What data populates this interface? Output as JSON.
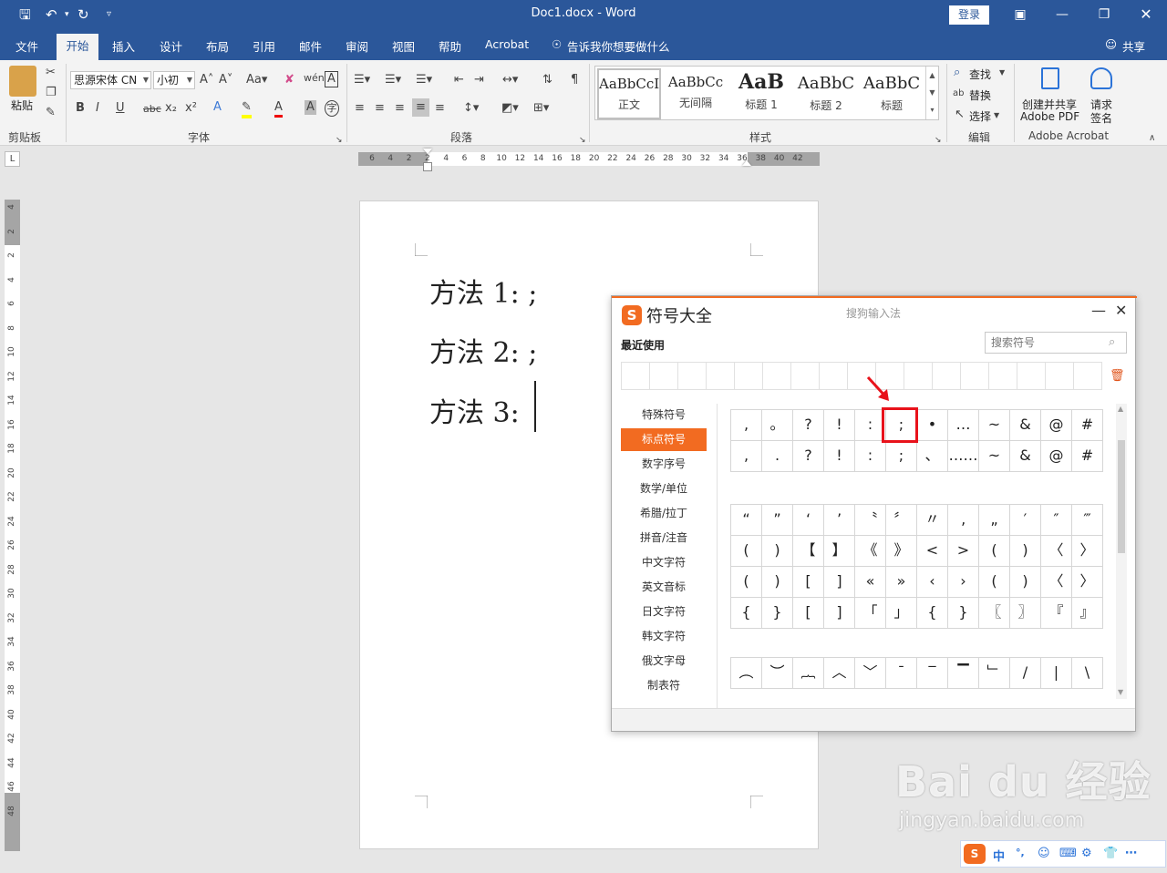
{
  "window": {
    "doc_title": "Doc1.docx  -  Word",
    "login": "登录",
    "restore_icon": "restore-window",
    "minimize_icon": "minimize",
    "maximize_icon": "maximize",
    "close_icon": "close"
  },
  "tabs": [
    "文件",
    "开始",
    "插入",
    "设计",
    "布局",
    "引用",
    "邮件",
    "审阅",
    "视图",
    "帮助",
    "Acrobat"
  ],
  "tell_me": "告诉我你想要做什么",
  "share": "共享",
  "ribbon": {
    "paste": "粘贴",
    "clipboard": "剪贴板",
    "font_name": "思源宋体 CN",
    "font_size": "小初",
    "font_group": "字体",
    "para_group": "段落",
    "styles_group": "样式",
    "edit_group": "编辑",
    "acrobat_group": "Adobe Acrobat",
    "find": "查找",
    "replace": "替换",
    "select": "选择",
    "create_pdf_1": "创建并共享",
    "create_pdf_2": "Adobe PDF",
    "request_sign_1": "请求",
    "request_sign_2": "签名",
    "styles": [
      {
        "preview": "AaBbCcI",
        "name": "正文"
      },
      {
        "preview": "AaBbCc",
        "name": "无间隔"
      },
      {
        "preview": "AaB",
        "name": "标题 1"
      },
      {
        "preview": "AaBbC",
        "name": "标题 2"
      },
      {
        "preview": "AaBbC",
        "name": "标题"
      }
    ]
  },
  "ruler_h": [
    "6",
    "4",
    "2",
    "2",
    "4",
    "6",
    "8",
    "10",
    "12",
    "14",
    "16",
    "18",
    "20",
    "22",
    "24",
    "26",
    "28",
    "30",
    "32",
    "34",
    "36",
    "38",
    "40",
    "42"
  ],
  "ruler_v": [
    "4",
    "2",
    "2",
    "4",
    "6",
    "8",
    "10",
    "12",
    "14",
    "16",
    "18",
    "20",
    "22",
    "24",
    "26",
    "28",
    "30",
    "32",
    "34",
    "36",
    "38",
    "40",
    "42",
    "44",
    "46",
    "48"
  ],
  "document": {
    "lines": [
      "方法 1: ;",
      "方法 2: ;",
      "方法 3: "
    ]
  },
  "symbol_dialog": {
    "title": "符号大全",
    "subtitle": "搜狗输入法",
    "recent_label": "最近使用",
    "search_placeholder": "搜索符号",
    "categories": [
      "特殊符号",
      "标点符号",
      "数字序号",
      "数学/单位",
      "希腊/拉丁",
      "拼音/注音",
      "中文字符",
      "英文音标",
      "日文字符",
      "韩文字符",
      "俄文字母",
      "制表符"
    ],
    "selected_category": "标点符号",
    "grid1": [
      [
        ",",
        "。",
        "?",
        "!",
        ":",
        ";",
        "•",
        "…",
        "~",
        "&",
        "@",
        "#"
      ],
      [
        ",",
        ".",
        "?",
        "!",
        ":",
        ";",
        "、",
        "……",
        "~",
        "&",
        "@",
        "#"
      ]
    ],
    "grid2": [
      [
        "“",
        "”",
        "‘",
        "’",
        "〝",
        "〞",
        "〃",
        "‚",
        "„",
        "′",
        "″",
        "‴"
      ],
      [
        "(",
        ")",
        "【",
        "】",
        "《",
        "》",
        "<",
        ">",
        "(",
        ")",
        "〈",
        "〉"
      ],
      [
        "(",
        ")",
        "[",
        "]",
        "«",
        "»",
        "‹",
        "›",
        "(",
        ")",
        "〈",
        "〉"
      ],
      [
        "{",
        "}",
        "[",
        "]",
        "「",
        "」",
        "{",
        "}",
        "〖",
        "〗",
        "『",
        "』"
      ]
    ],
    "grid3": [
      [
        "︵",
        "︶",
        "︷",
        "︿",
        "﹀",
        "ˉ",
        "‾",
        "▔",
        "﹂",
        "/",
        "|",
        "\\"
      ]
    ]
  },
  "ime_bar": [
    "中",
    "°,",
    "☺",
    "⌨",
    "⚙",
    "👕",
    "⋯"
  ],
  "watermark": {
    "brand": "Bai du 经验",
    "url": "jingyan.baidu.com"
  }
}
